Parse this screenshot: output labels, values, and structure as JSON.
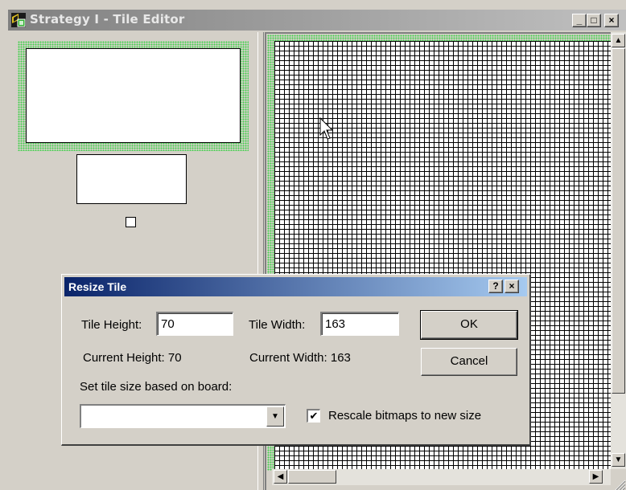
{
  "window": {
    "title": "Strategy I - Tile Editor",
    "controls": {
      "minimize": "_",
      "maximize": "□",
      "close": "×"
    }
  },
  "icons": {
    "app": "tile-editor-app-icon",
    "cursor": "arrow-cursor-icon"
  },
  "dialog": {
    "title": "Resize Tile",
    "help_button": "?",
    "close_button": "×",
    "tile_height_label": "Tile Height:",
    "tile_height_value": "70",
    "tile_width_label": "Tile Width:",
    "tile_width_value": "163",
    "current_height": "Current Height: 70",
    "current_width": "Current Width: 163",
    "board_label": "Set tile size based on board:",
    "board_selected": "",
    "rescale_label": "Rescale bitmaps to new size",
    "rescale_checked": true,
    "ok_label": "OK",
    "cancel_label": "Cancel"
  },
  "colors": {
    "titlebar_active": "#0a246a",
    "titlebar_inactive": "#808080",
    "selection_dots": "#3fd04a"
  }
}
